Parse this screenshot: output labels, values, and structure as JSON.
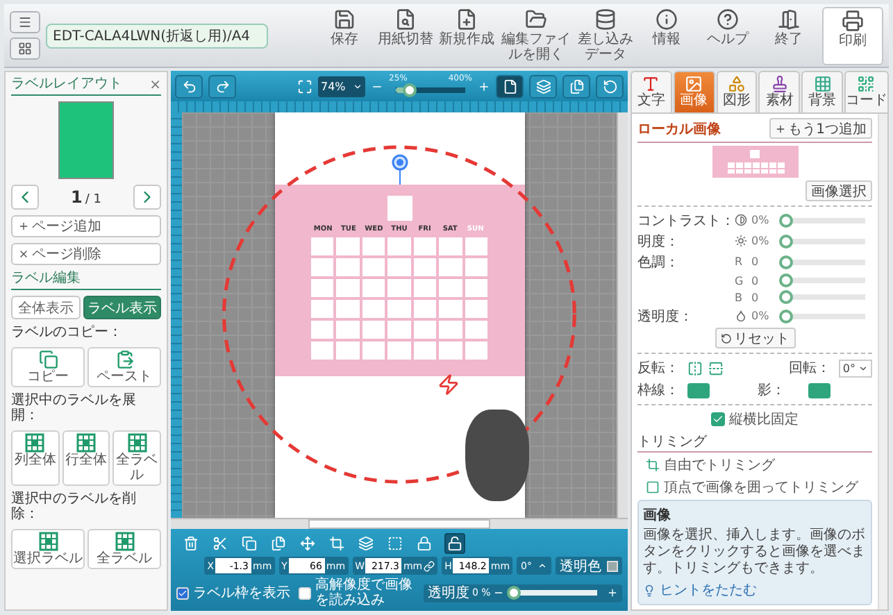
{
  "app_bar": {
    "file_name": "EDT-CALA4LWN(折返し用)/A4",
    "tools": [
      {
        "label": "保存"
      },
      {
        "label": "用紙切替"
      },
      {
        "label": "新規作成"
      },
      {
        "label": "編集ファイルを開く"
      },
      {
        "label": "差し込みデータ"
      },
      {
        "label": "情報"
      },
      {
        "label": "ヘルプ"
      },
      {
        "label": "終了"
      },
      {
        "label": "印刷"
      }
    ]
  },
  "layout_panel": {
    "title": "ラベルレイアウト",
    "close": "×",
    "page_current": "1",
    "page_rest": "/ 1",
    "page_buttons": [
      {
        "label": "ページ追加"
      },
      {
        "label": "ページ削除"
      }
    ],
    "edit_title": "ラベル編集",
    "view_toggle": [
      {
        "label": "全体表示",
        "selected": false
      },
      {
        "label": "ラベル表示",
        "selected": true
      }
    ],
    "groups": [
      {
        "title": "ラベルのコピー：",
        "buttons": [
          {
            "label": "コピー",
            "kind": "copy"
          },
          {
            "label": "ペースト",
            "kind": "paste"
          }
        ]
      },
      {
        "title": "選択中のラベルを展開：",
        "buttons": [
          {
            "label": "列全体",
            "kind": "grid"
          },
          {
            "label": "行全体",
            "kind": "grid"
          },
          {
            "label": "全ラベル",
            "kind": "grid"
          }
        ]
      },
      {
        "title": "選択中のラベルを削除：",
        "buttons": [
          {
            "label": "選択ラベル",
            "kind": "grid"
          },
          {
            "label": "全ラベル",
            "kind": "grid"
          }
        ]
      }
    ]
  },
  "editor": {
    "zoom": {
      "value": "74%",
      "min_label": "25%",
      "max_label": "400%",
      "level": 0.2
    },
    "calendar": {
      "days": [
        "MON",
        "TUE",
        "WED",
        "THU",
        "FRI",
        "SAT",
        "SUN"
      ]
    },
    "position": [
      {
        "label": "X",
        "value": "-1.3",
        "unit": "mm"
      },
      {
        "label": "Y",
        "value": "66",
        "unit": "mm"
      },
      {
        "label": "W",
        "value": "217.3",
        "unit": "mm"
      },
      {
        "label": "H",
        "value": "148.2",
        "unit": "mm"
      }
    ],
    "rotation": "0°",
    "transparent_color": "透明色",
    "show_frame": {
      "label": "ラベル枠を表示",
      "checked": true
    },
    "high_res": {
      "label": "高解像度で画像を読み込み",
      "checked": false
    },
    "opacity": {
      "label": "透明度",
      "value": "0 %",
      "level": 0
    }
  },
  "properties": {
    "tabs": [
      {
        "label": "文字",
        "selected": false
      },
      {
        "label": "画像",
        "selected": true
      },
      {
        "label": "図形",
        "selected": false
      },
      {
        "label": "素材",
        "selected": false
      },
      {
        "label": "背景",
        "selected": false
      },
      {
        "label": "コード",
        "selected": false
      }
    ],
    "section_title": "ローカル画像",
    "add_button": "もう1つ追加",
    "select_button": "画像選択",
    "adjustments": [
      {
        "label": "コントラスト：",
        "value": "0%",
        "level": 0
      },
      {
        "label": "明度：",
        "value": "0%",
        "level": 0
      },
      {
        "label": "色調：",
        "channel": "R",
        "value": "0",
        "level": 0
      },
      {
        "channel": "G",
        "value": "0",
        "level": 0
      },
      {
        "channel": "B",
        "value": "0",
        "level": 0
      },
      {
        "label": "透明度：",
        "value": "0%",
        "level": 0
      }
    ],
    "reset_button": "リセット",
    "flip_label": "反転：",
    "rotate_label": "回転：",
    "rotate_value": "0°",
    "border_label": "枠線：",
    "shadow_label": "影：",
    "keep_ratio": {
      "label": "縦横比固定",
      "checked": true
    },
    "trimming": {
      "title": "トリミング",
      "options": [
        "自由でトリミング",
        "頂点で画像を囲ってトリミング"
      ]
    },
    "hint": {
      "title": "画像",
      "text": "画像を選択、挿入します。画像のボタンをクリックすると画像を選べます。トリミングもできます。",
      "collapse": "ヒントをたたむ"
    }
  }
}
